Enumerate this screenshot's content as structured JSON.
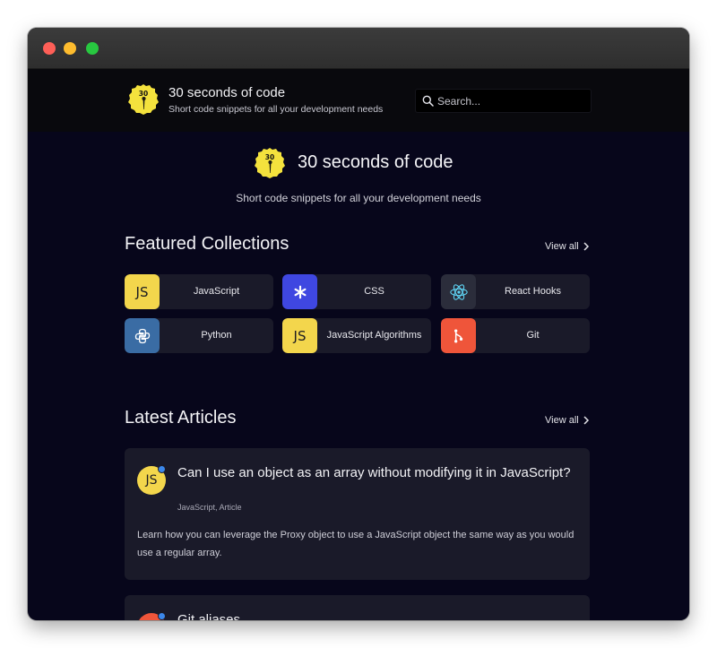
{
  "site": {
    "name": "30 seconds of code",
    "tagline": "Short code snippets for all your development needs",
    "logo_text": "30"
  },
  "search": {
    "placeholder": "Search..."
  },
  "featured": {
    "title": "Featured Collections",
    "view_all": "View all",
    "collections": [
      {
        "label": "JavaScript",
        "icon": "javascript-icon",
        "color": "#f3d64c"
      },
      {
        "label": "CSS",
        "icon": "css-asterisk-icon",
        "color": "#3f47e1"
      },
      {
        "label": "React Hooks",
        "icon": "react-atom-icon",
        "color": "#2b2d3b"
      },
      {
        "label": "Python",
        "icon": "python-icon",
        "color": "#3a6ca4"
      },
      {
        "label": "JavaScript Algorithms",
        "icon": "javascript-icon",
        "color": "#f3d64c"
      },
      {
        "label": "Git",
        "icon": "git-icon",
        "color": "#ef553a"
      }
    ]
  },
  "articles": {
    "title": "Latest Articles",
    "view_all": "View all",
    "items": [
      {
        "title": "Can I use an object as an array without modifying it in JavaScript?",
        "tags": "JavaScript, Article",
        "description": "Learn how you can leverage the Proxy object to use a JavaScript object the same way as you would use a regular array.",
        "avatar_text": "JS",
        "avatar_color": "#f3d64c"
      },
      {
        "title": "Git aliases",
        "avatar_color": "#ef553a"
      }
    ]
  },
  "colors": {
    "page_bg": "#07061b",
    "card_bg": "#1a1a29",
    "header_bg": "#09090d",
    "logo_yellow": "#f4e23d",
    "badge_blue": "#3b87ea"
  }
}
